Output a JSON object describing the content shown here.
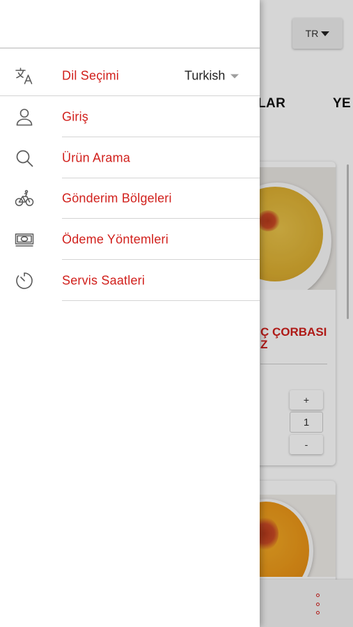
{
  "background": {
    "language_button": "TR",
    "tabs": [
      "MALAR",
      "YE"
    ],
    "product": {
      "title_line1": "Ç ÇORBASI",
      "title_line2": "Z"
    },
    "stepper": {
      "plus": "+",
      "quantity": "1",
      "minus": "-"
    }
  },
  "drawer": {
    "language_item": {
      "label": "Dil Seçimi",
      "selected": "Turkish",
      "icon": "translate-icon"
    },
    "items": [
      {
        "label": "Giriş",
        "icon": "person-icon"
      },
      {
        "label": "Ürün Arama",
        "icon": "search-icon"
      },
      {
        "label": "Gönderim Bölgeleri",
        "icon": "bicycle-icon"
      },
      {
        "label": "Ödeme Yöntemleri",
        "icon": "cash-icon"
      },
      {
        "label": "Servis Saatleri",
        "icon": "timer-icon"
      }
    ]
  },
  "colors": {
    "accent": "#d1201c",
    "icon": "#5a5a5a",
    "divider": "#d4d4d4"
  }
}
